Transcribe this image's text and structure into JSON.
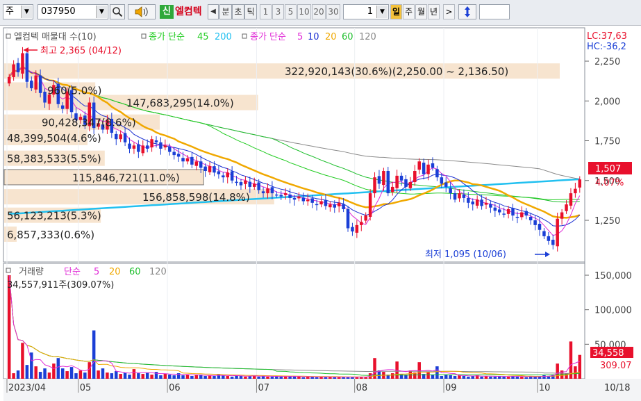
{
  "toolbar": {
    "market_label": "주",
    "code_value": "037950",
    "new_badge": "신",
    "stock_name": "엘컴텍",
    "prev_label": "◀",
    "unit_min": "분",
    "unit_sec": "초",
    "unit_tick": "틱",
    "periods": [
      "1",
      "3",
      "5",
      "10",
      "20",
      "30"
    ],
    "count_value": "1",
    "day_label": "일",
    "week_label": "주",
    "month_label": "월",
    "year_label": "년",
    "next_label": ">"
  },
  "colors": {
    "up": "#e8102c",
    "down": "#1b3fd6",
    "ma5_price": "#e02ad6",
    "ma10_price": "#1b2fd1",
    "ma20_price": "#f0a800",
    "ma60_price": "#1fbf2e",
    "ma120_price": "#8a8a8a",
    "ma45_close": "#22cc22",
    "ma200_close": "#21c0f0",
    "vol_ma5": "#e02ad6",
    "vol_ma20": "#f0a800",
    "vol_ma60": "#1fbf2e",
    "vol_ma120": "#8a8a8a"
  },
  "price_panel": {
    "legend": {
      "title": "엘컴텍 매물대 수(10)",
      "ma_close_title": "종가 단순",
      "ma_close_45": "45",
      "ma_close_200": "200",
      "ma_price_title": "종가 단순",
      "ma_price_5": "5",
      "ma_price_10": "10",
      "ma_price_20": "20",
      "ma_price_60": "60",
      "ma_price_120": "120"
    },
    "lc_label": "LC:37,63",
    "hc_label": "HC:-36,2",
    "high_marker": "최고 2,365 (04/12)",
    "low_marker": "최저 1,095 (10/06)",
    "current_price": "1,507",
    "current_change": "4.07%"
  },
  "volume_profile": [
    {
      "label": "322,920,143(30.6%)(2,250.00 ~ 2,136.50)",
      "y_price": 2188,
      "frac": 1.0
    },
    {
      "label": "960(5.0%)",
      "label_prefix": "53,",
      "y_price": 2069,
      "frac": 0.164
    },
    {
      "label": "147,683,295(14.0%)",
      "y_price": 1990,
      "frac": 0.457
    },
    {
      "label": "90,428,347(8.6%)",
      "y_price": 1867,
      "frac": 0.28
    },
    {
      "label": "48,399,504(4.6%)",
      "y_price": 1770,
      "frac": 0.15
    },
    {
      "label": "58,383,533(5.5%)",
      "y_price": 1640,
      "frac": 0.181
    },
    {
      "label": "115,846,721(11.0%)",
      "y_price": 1521,
      "frac": 0.359
    },
    {
      "label": "156,858,598(14.8%)",
      "y_price": 1398,
      "frac": 0.486
    },
    {
      "label": "56,123,213(5.3%)",
      "y_price": 1282,
      "frac": 0.174
    },
    {
      "label": "6,857,333(0.6%)",
      "y_price": 1163,
      "frac": 0.021
    }
  ],
  "volume_panel": {
    "legend": {
      "title": "거래량",
      "ma_title": "단순",
      "ma5": "5",
      "ma20": "20",
      "ma60": "60",
      "ma120": "120"
    },
    "last_volume_text": "34,557,911주(309.07%)",
    "current_volume": "34,558",
    "current_ratio": "309.07"
  },
  "chart_data": [
    {
      "type": "candlestick",
      "title": "엘컴텍",
      "ylim": [
        1060,
        2330
      ],
      "y_ticks": [
        2250,
        2000,
        1750,
        1500,
        1250
      ],
      "y_tick_labels": [
        "2,250",
        "2,000",
        "1,750",
        "1,500",
        "1,250"
      ],
      "x_tick_labels": [
        "2023/04",
        "05",
        "06",
        "07",
        "08",
        "09",
        "10",
        "10/18"
      ],
      "close_series": [
        2150,
        2230,
        2180,
        2300,
        2120,
        2080,
        2160,
        2050,
        1990,
        2040,
        2100,
        1980,
        1950,
        2060,
        1930,
        1880,
        1900,
        1850,
        1990,
        1830,
        1860,
        1820,
        1880,
        1800,
        1760,
        1790,
        1740,
        1700,
        1720,
        1680,
        1720,
        1700,
        1760,
        1740,
        1700,
        1720,
        1680,
        1660,
        1650,
        1620,
        1640,
        1600,
        1620,
        1580,
        1560,
        1590,
        1550,
        1540,
        1520,
        1550,
        1500,
        1490,
        1470,
        1500,
        1460,
        1480,
        1440,
        1420,
        1450,
        1420,
        1410,
        1400,
        1420,
        1390,
        1380,
        1400,
        1370,
        1380,
        1360,
        1350,
        1370,
        1340,
        1350,
        1330,
        1360,
        1320,
        1200,
        1180,
        1220,
        1240,
        1280,
        1420,
        1520,
        1480,
        1560,
        1420,
        1460,
        1530,
        1500,
        1460,
        1490,
        1560,
        1620,
        1540,
        1600,
        1580,
        1520,
        1480,
        1460,
        1420,
        1380,
        1420,
        1390,
        1360,
        1350,
        1380,
        1340,
        1360,
        1330,
        1310,
        1300,
        1290,
        1320,
        1280,
        1270,
        1300,
        1280,
        1250,
        1220,
        1190,
        1150,
        1120,
        1095,
        1260,
        1300,
        1350,
        1420,
        1448,
        1507
      ],
      "series": [
        {
          "name": "종가 단순 45"
        },
        {
          "name": "종가 단순 200"
        },
        {
          "name": "종가 단순 5"
        },
        {
          "name": "종가 단순 10"
        },
        {
          "name": "종가 단순 20"
        },
        {
          "name": "종가 단순 60"
        },
        {
          "name": "종가 단순 120"
        }
      ],
      "annotations": [
        "최고 2,365 (04/12)",
        "최저 1,095 (10/06)"
      ]
    },
    {
      "type": "bar",
      "title": "거래량",
      "ylim": [
        0,
        160000
      ],
      "y_ticks": [
        150000,
        100000,
        50000
      ],
      "y_tick_labels": [
        "150,000",
        "100,000",
        "50,000"
      ],
      "volume_thousands": [
        150000,
        8000,
        12000,
        52000,
        20000,
        38000,
        18000,
        10000,
        15000,
        9000,
        22000,
        30000,
        15000,
        11000,
        17000,
        8000,
        12000,
        9000,
        24000,
        70000,
        12000,
        15000,
        9000,
        8000,
        11000,
        7000,
        9000,
        6000,
        14000,
        8000,
        7000,
        9000,
        6000,
        10000,
        5000,
        7000,
        6000,
        5000,
        8000,
        5000,
        6000,
        4000,
        5000,
        6000,
        4000,
        5000,
        4000,
        6000,
        5000,
        4000,
        3000,
        5000,
        4000,
        3000,
        4000,
        5000,
        3000,
        4000,
        3000,
        3000,
        4000,
        3000,
        3000,
        4000,
        3000,
        3000,
        2000,
        3000,
        3000,
        2000,
        3000,
        2000,
        3000,
        2000,
        2000,
        3000,
        2000,
        3000,
        2000,
        2000,
        3000,
        8000,
        30000,
        12000,
        10000,
        6000,
        8000,
        25000,
        7000,
        6000,
        12000,
        9000,
        24000,
        7000,
        10000,
        6000,
        18000,
        4000,
        6000,
        5000,
        4000,
        5000,
        4000,
        3000,
        4000,
        5000,
        3000,
        4000,
        3000,
        3000,
        4000,
        3000,
        3000,
        4000,
        3000,
        3000,
        2000,
        3000,
        3000,
        4000,
        5000,
        4000,
        6000,
        22000,
        12000,
        8000,
        54000,
        18000,
        34558
      ]
    }
  ]
}
